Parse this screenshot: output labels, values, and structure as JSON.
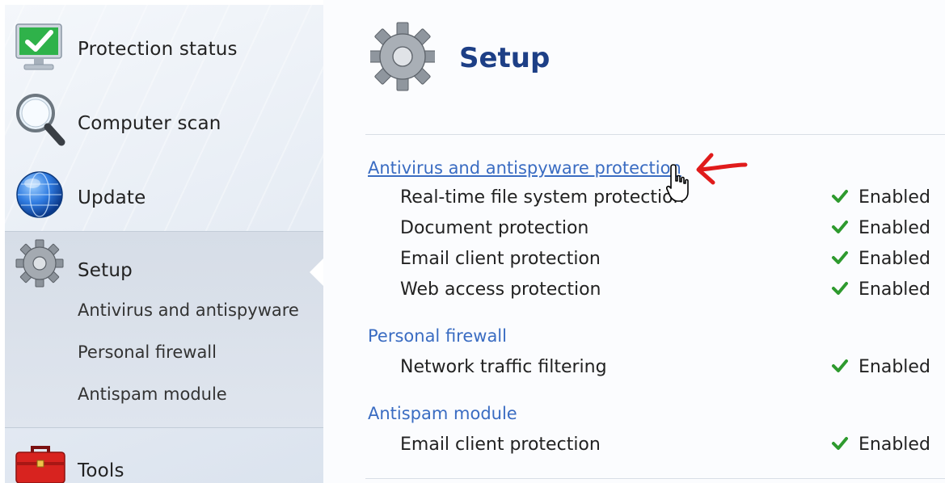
{
  "sidebar": {
    "items": [
      {
        "label": "Protection status",
        "icon": "monitor-check-icon"
      },
      {
        "label": "Computer scan",
        "icon": "magnifier-icon"
      },
      {
        "label": "Update",
        "icon": "globe-icon"
      },
      {
        "label": "Setup",
        "icon": "gear-icon"
      },
      {
        "label": "Tools",
        "icon": "toolbox-icon"
      }
    ],
    "setup_subitems": [
      {
        "label": "Antivirus and antispyware"
      },
      {
        "label": "Personal firewall"
      },
      {
        "label": "Antispam module"
      }
    ]
  },
  "main": {
    "title": "Setup",
    "title_icon": "gear-icon",
    "sections": [
      {
        "title": "Antivirus and antispyware protection",
        "rows": [
          {
            "label": "Real-time file system protection",
            "status": "Enabled"
          },
          {
            "label": "Document protection",
            "status": "Enabled"
          },
          {
            "label": "Email client protection",
            "status": "Enabled"
          },
          {
            "label": "Web access protection",
            "status": "Enabled"
          }
        ]
      },
      {
        "title": "Personal firewall",
        "rows": [
          {
            "label": "Network traffic filtering",
            "status": "Enabled"
          }
        ]
      },
      {
        "title": "Antispam module",
        "rows": [
          {
            "label": "Email client protection",
            "status": "Enabled"
          }
        ]
      }
    ]
  },
  "annotations": {
    "arrow_color": "#e01b1b",
    "cursor": "hand-pointer-icon"
  },
  "colors": {
    "link": "#3a6cc2",
    "title": "#1d3f86",
    "check": "#2e9a2e"
  }
}
